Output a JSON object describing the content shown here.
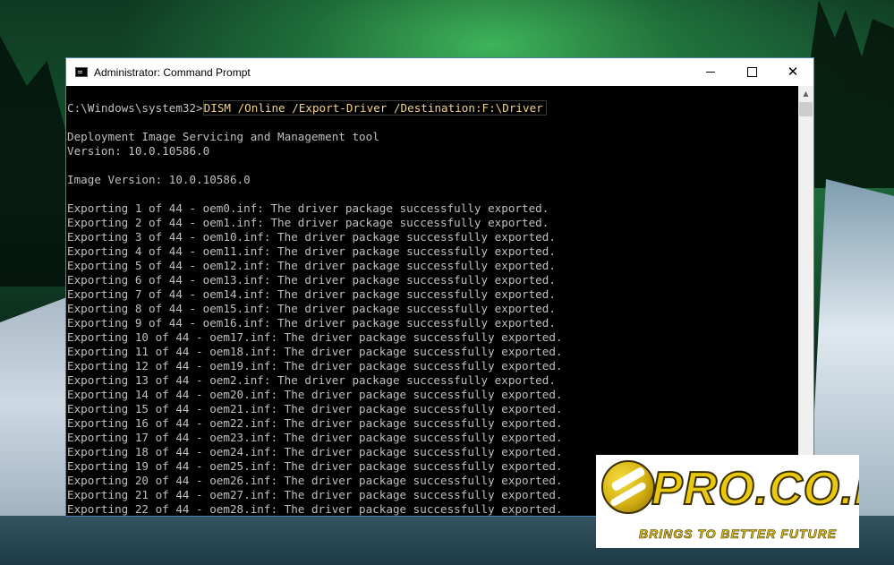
{
  "window": {
    "title": "Administrator: Command Prompt"
  },
  "console": {
    "prompt": "C:\\Windows\\system32>",
    "command": "DISM /Online /Export-Driver /Destination:F:\\Driver",
    "tool_name": "Deployment Image Servicing and Management tool",
    "version": "Version: 10.0.10586.0",
    "image_version": "Image Version: 10.0.10586.0",
    "export_lines": [
      "Exporting 1 of 44 - oem0.inf: The driver package successfully exported.",
      "Exporting 2 of 44 - oem1.inf: The driver package successfully exported.",
      "Exporting 3 of 44 - oem10.inf: The driver package successfully exported.",
      "Exporting 4 of 44 - oem11.inf: The driver package successfully exported.",
      "Exporting 5 of 44 - oem12.inf: The driver package successfully exported.",
      "Exporting 6 of 44 - oem13.inf: The driver package successfully exported.",
      "Exporting 7 of 44 - oem14.inf: The driver package successfully exported.",
      "Exporting 8 of 44 - oem15.inf: The driver package successfully exported.",
      "Exporting 9 of 44 - oem16.inf: The driver package successfully exported.",
      "Exporting 10 of 44 - oem17.inf: The driver package successfully exported.",
      "Exporting 11 of 44 - oem18.inf: The driver package successfully exported.",
      "Exporting 12 of 44 - oem19.inf: The driver package successfully exported.",
      "Exporting 13 of 44 - oem2.inf: The driver package successfully exported.",
      "Exporting 14 of 44 - oem20.inf: The driver package successfully exported.",
      "Exporting 15 of 44 - oem21.inf: The driver package successfully exported.",
      "Exporting 16 of 44 - oem22.inf: The driver package successfully exported.",
      "Exporting 17 of 44 - oem23.inf: The driver package successfully exported.",
      "Exporting 18 of 44 - oem24.inf: The driver package successfully exported.",
      "Exporting 19 of 44 - oem25.inf: The driver package successfully exported.",
      "Exporting 20 of 44 - oem26.inf: The driver package successfully exported.",
      "Exporting 21 of 44 - oem27.inf: The driver package successfully exported.",
      "Exporting 22 of 44 - oem28.inf: The driver package successfully exported."
    ]
  },
  "controls": {
    "minimize_icon": "minimize-icon",
    "maximize_icon": "maximize-icon",
    "close_icon": "close-icon",
    "close_glyph": "✕"
  },
  "scrollbar": {
    "up_glyph": "▲",
    "down_glyph": "▼"
  },
  "watermark": {
    "brand": "PRO.CO.ID",
    "tagline": "BRINGS TO BETTER FUTURE"
  },
  "colors": {
    "console_bg": "#000000",
    "console_text": "#c0c0c0",
    "command_text": "#f2d48a",
    "logo_gold": "#e9c80f"
  }
}
